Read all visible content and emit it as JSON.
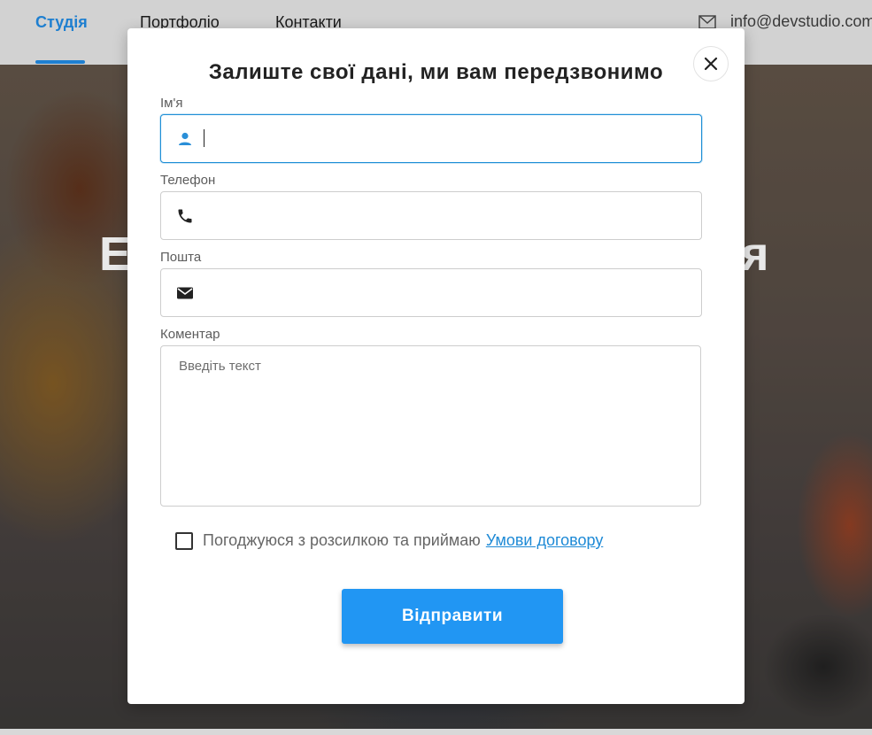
{
  "header": {
    "nav": [
      {
        "label": "Студія",
        "active": true
      },
      {
        "label": "Портфоліо",
        "active": false
      },
      {
        "label": "Контакти",
        "active": false
      }
    ],
    "email": "info@devstudio.com",
    "email_icon": "envelope-outline-icon",
    "accent_color": "#1e7fd0"
  },
  "hero": {
    "letter_left": "Е",
    "letter_right": "я"
  },
  "modal": {
    "title": "Залиште свої дані, ми вам передзвонимо",
    "close_icon": "close-icon",
    "fields": {
      "name": {
        "label": "Ім'я",
        "icon": "user-icon",
        "value": ""
      },
      "phone": {
        "label": "Телефон",
        "icon": "phone-icon",
        "value": ""
      },
      "email": {
        "label": "Пошта",
        "icon": "mail-icon",
        "value": ""
      },
      "comment": {
        "label": "Коментар",
        "placeholder": "Введіть текст",
        "value": ""
      }
    },
    "consent": {
      "text": "Погоджуюся з розсилкою та приймаю",
      "link": "Умови договору",
      "checked": false
    },
    "submit_label": "Відправити",
    "button_color": "#2196f3"
  }
}
